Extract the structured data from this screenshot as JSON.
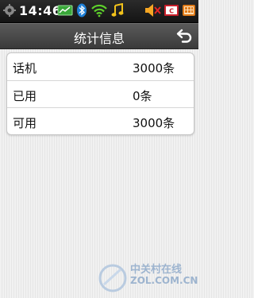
{
  "status_bar": {
    "time": "14:46",
    "icons": [
      "settings-icon",
      "message-icon",
      "bluetooth-icon",
      "wifi-icon",
      "music-icon",
      "volume-muted-icon",
      "sim-icon",
      "battery-icon"
    ]
  },
  "header": {
    "title": "统计信息",
    "back_icon": "back-arrow-icon"
  },
  "stats": {
    "rows": [
      {
        "label": "话机",
        "value": "3000条"
      },
      {
        "label": "已用",
        "value": "0条"
      },
      {
        "label": "可用",
        "value": "3000条"
      }
    ]
  },
  "watermark": {
    "line1": "中关村在线",
    "line2": "ZOL.COM.CN"
  },
  "colors": {
    "status_bar_bg": "#141414",
    "title_bar_bg": "#4a4a4a",
    "card_bg": "#ffffff",
    "message_icon_green": "#3aa83a",
    "bluetooth_blue": "#1e7fd6",
    "wifi_green": "#5ed12b",
    "music_yellow": "#f2c21b",
    "sim_red": "#c8202c",
    "battery_orange": "#e07a18"
  }
}
